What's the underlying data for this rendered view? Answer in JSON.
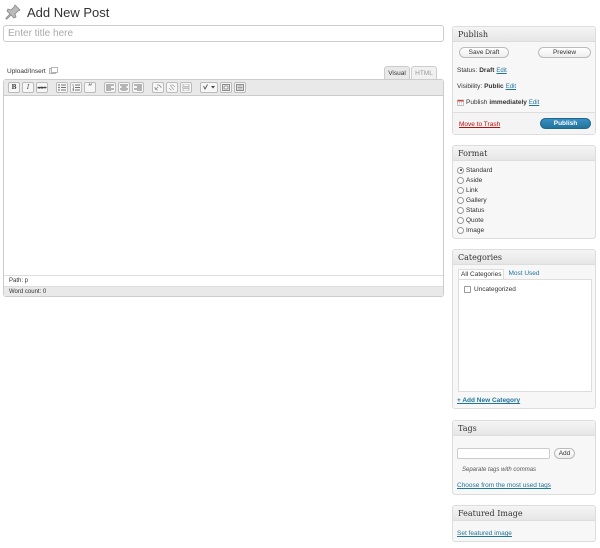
{
  "header": {
    "title": "Add New Post",
    "icon": "pushpin-icon"
  },
  "title_field": {
    "placeholder": "Enter title here",
    "value": ""
  },
  "editor": {
    "upload_label": "Upload/Insert",
    "tabs": [
      {
        "label": "Visual",
        "active": true
      },
      {
        "label": "HTML",
        "active": false
      }
    ],
    "toolbar": [
      {
        "name": "bold-button",
        "glyph": "B"
      },
      {
        "name": "italic-button",
        "glyph": "I"
      },
      {
        "name": "strikethrough-button",
        "glyph": "ABC"
      },
      {
        "name": "bullet-list-button",
        "icon": "bullet-list-icon"
      },
      {
        "name": "numbered-list-button",
        "icon": "numbered-list-icon"
      },
      {
        "name": "blockquote-button",
        "glyph": "“"
      },
      {
        "name": "align-left-button",
        "icon": "align-left-icon"
      },
      {
        "name": "align-center-button",
        "icon": "align-center-icon"
      },
      {
        "name": "align-right-button",
        "icon": "align-right-icon"
      },
      {
        "name": "insert-link-button",
        "icon": "link-icon"
      },
      {
        "name": "unlink-button",
        "icon": "unlink-icon"
      },
      {
        "name": "insert-more-button",
        "icon": "more-tag-icon"
      },
      {
        "name": "spellcheck-button",
        "icon": "spellcheck-icon"
      },
      {
        "name": "fullscreen-button",
        "icon": "fullscreen-icon"
      },
      {
        "name": "kitchen-sink-button",
        "icon": "kitchen-sink-icon"
      }
    ],
    "path": "Path: p",
    "word_count": "Word count: 0"
  },
  "publish": {
    "title": "Publish",
    "save_draft": "Save Draft",
    "preview": "Preview",
    "status_label": "Status:",
    "status_value": "Draft",
    "visibility_label": "Visibility:",
    "visibility_value": "Public",
    "schedule_label": "Publish",
    "schedule_value": "immediately",
    "edit": "Edit",
    "trash": "Move to Trash",
    "publish_button": "Publish"
  },
  "format": {
    "title": "Format",
    "options": [
      "Standard",
      "Aside",
      "Link",
      "Gallery",
      "Status",
      "Quote",
      "Image"
    ],
    "selected": "Standard"
  },
  "categories": {
    "title": "Categories",
    "tab_all": "All Categories",
    "tab_most": "Most Used",
    "items": [
      {
        "label": "Uncategorized",
        "checked": false
      }
    ],
    "add_link": "+ Add New Category"
  },
  "tags": {
    "title": "Tags",
    "add_button": "Add",
    "hint": "Separate tags with commas",
    "choose_link": "Choose from the most used tags"
  },
  "featured_image": {
    "title": "Featured Image",
    "set_link": "Set featured image"
  },
  "colors": {
    "link": "#21759b",
    "publish_button": "#21759b",
    "trash": "#bc0b0b"
  }
}
